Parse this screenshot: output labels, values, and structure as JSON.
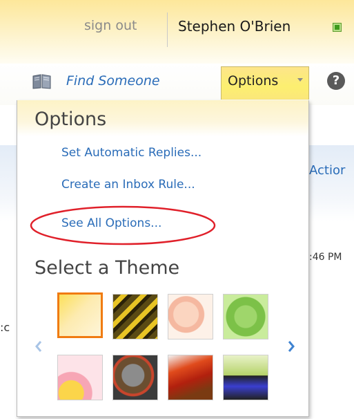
{
  "header": {
    "sign_out": "sign out",
    "user_name": "Stephen O'Brien"
  },
  "nav": {
    "find_someone": "Find Someone",
    "options_tab": "Options",
    "help_icon_glyph": "?"
  },
  "background": {
    "partial_action": "Actior",
    "partial_time": ":46 PM",
    "partial_text": ":c"
  },
  "options_menu": {
    "title": "Options",
    "items": [
      {
        "label": "Set Automatic Replies..."
      },
      {
        "label": "Create an Inbox Rule..."
      },
      {
        "label": "See All Options..."
      }
    ],
    "highlight_color": "#e0202a"
  },
  "themes": {
    "title": "Select a Theme",
    "selected_index": 0,
    "selected_border_color": "#f07b12"
  },
  "colors": {
    "link": "#2a6cb8",
    "presence": "#3e9a1c",
    "options_tab": "#fcef70"
  }
}
